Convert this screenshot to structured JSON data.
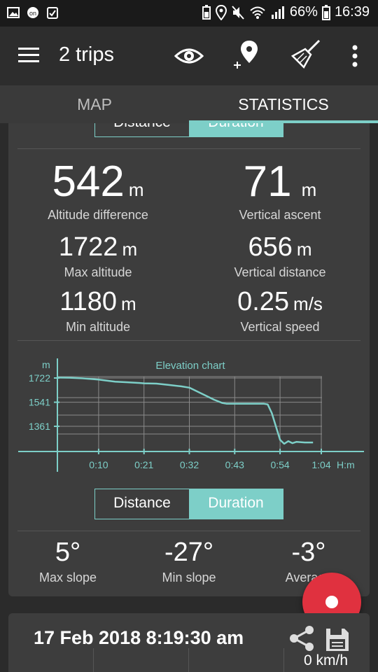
{
  "status_bar": {
    "battery": "66%",
    "time": "16:39",
    "left_icons": [
      "image-icon",
      "one-icon",
      "checkbox-icon"
    ],
    "right_icons": [
      "battery-saver-icon",
      "location-icon",
      "mute-icon",
      "wifi-icon",
      "signal-icon"
    ]
  },
  "toolbar": {
    "title": "2 trips",
    "icons": [
      "menu-icon",
      "eye-icon",
      "add-location-icon",
      "broom-icon",
      "more-vert-icon"
    ]
  },
  "tabs": [
    {
      "label": "MAP",
      "active": false
    },
    {
      "label": "STATISTICS",
      "active": true
    }
  ],
  "segment_top": {
    "left": "Distance",
    "right": "Duration",
    "selected": "Duration"
  },
  "stats": {
    "altitude_difference": {
      "value": "542",
      "unit": "m",
      "label": "Altitude difference"
    },
    "vertical_ascent": {
      "value": "71",
      "unit": "m",
      "label": "Vertical ascent"
    },
    "max_altitude": {
      "value": "1722",
      "unit": "m",
      "label": "Max altitude"
    },
    "vertical_distance": {
      "value": "656",
      "unit": "m",
      "label": "Vertical distance"
    },
    "min_altitude": {
      "value": "1180",
      "unit": "m",
      "label": "Min altitude"
    },
    "vertical_speed": {
      "value": "0.25",
      "unit": "m/s",
      "label": "Vertical speed"
    }
  },
  "chart_data": {
    "type": "line",
    "title": "Elevation chart",
    "ylabel": "m",
    "xlabel": "H:m",
    "y_ticks": [
      "1722",
      "1541",
      "1361"
    ],
    "y_tick_values": [
      1722,
      1541,
      1361
    ],
    "x_ticks": [
      "0:10",
      "0:21",
      "0:32",
      "0:43",
      "0:54",
      "1:04"
    ],
    "x_tick_values": [
      10,
      21,
      32,
      43,
      54,
      64
    ],
    "xlim": [
      0,
      66
    ],
    "ylim": [
      1180,
      1760
    ],
    "grid": true,
    "series": [
      {
        "x": [
          0,
          3,
          6,
          10,
          14,
          17,
          20,
          21,
          24,
          27,
          30,
          32,
          34,
          36,
          38,
          40,
          41,
          43,
          46,
          50,
          51,
          52,
          53,
          54,
          55,
          56,
          57,
          58,
          60,
          62
        ],
        "y": [
          1725,
          1724,
          1720,
          1710,
          1695,
          1690,
          1685,
          1682,
          1680,
          1670,
          1660,
          1650,
          1620,
          1590,
          1560,
          1535,
          1530,
          1530,
          1530,
          1530,
          1525,
          1460,
          1360,
          1260,
          1230,
          1250,
          1235,
          1245,
          1240,
          1240
        ]
      }
    ],
    "color": "#7dcfc8"
  },
  "segment_bottom": {
    "left": "Distance",
    "right": "Duration",
    "selected": "Duration"
  },
  "slopes": {
    "max": {
      "value": "5°",
      "label": "Max slope"
    },
    "min": {
      "value": "-27°",
      "label": "Min slope"
    },
    "avg": {
      "value": "-3°",
      "label": "Average"
    }
  },
  "fab": {
    "icon": "record-icon"
  },
  "trip": {
    "date": "17 Feb 2018 8:19:30 am",
    "speed": "0 km/h",
    "icons": [
      "share-icon",
      "save-icon"
    ]
  },
  "colors": {
    "accent": "#7dcfc8",
    "record": "#e0313f",
    "background": "#2b2b2b",
    "card": "#3d3d3d"
  }
}
